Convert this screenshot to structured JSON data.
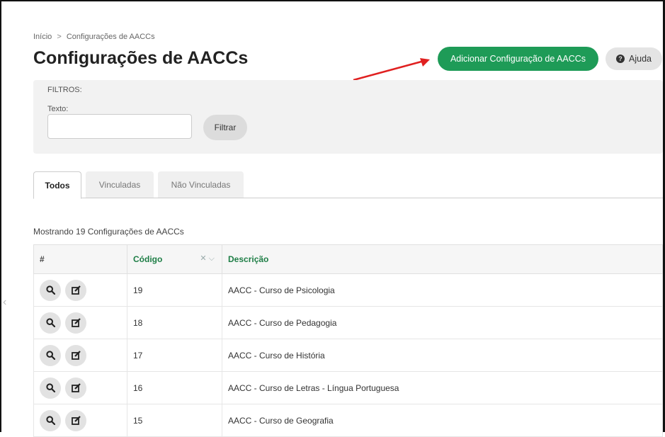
{
  "breadcrumb": {
    "items": [
      "Início",
      "Configurações de AACCs"
    ],
    "separator": ">"
  },
  "page": {
    "title": "Configurações de AACCs"
  },
  "actions": {
    "add_label": "Adicionar Configuração de AACCs",
    "help_label": "Ajuda",
    "help_icon": "?"
  },
  "filters": {
    "title": "FILTROS:",
    "text_label": "Texto:",
    "text_value": "",
    "filter_button": "Filtrar"
  },
  "tabs": [
    {
      "label": "Todos",
      "active": true
    },
    {
      "label": "Vinculadas",
      "active": false
    },
    {
      "label": "Não Vinculadas",
      "active": false
    }
  ],
  "result_count": "Mostrando 19 Configurações de AACCs",
  "table": {
    "headers": [
      "#",
      "Código",
      "Descrição"
    ],
    "rows": [
      {
        "code": "19",
        "description": "AACC - Curso de Psicologia"
      },
      {
        "code": "18",
        "description": "AACC - Curso de Pedagogia"
      },
      {
        "code": "17",
        "description": "AACC - Curso de História"
      },
      {
        "code": "16",
        "description": "AACC - Curso de Letras - Língua Portuguesa"
      },
      {
        "code": "15",
        "description": "AACC - Curso de Geografia"
      }
    ]
  },
  "colors": {
    "primary_green": "#1e9b57",
    "header_green": "#1e7e46",
    "annotation_red": "#e02020"
  },
  "icons": {
    "view": "search-icon",
    "edit": "edit-icon",
    "clear_sort": "close-icon",
    "sort": "chevron-down-icon"
  }
}
